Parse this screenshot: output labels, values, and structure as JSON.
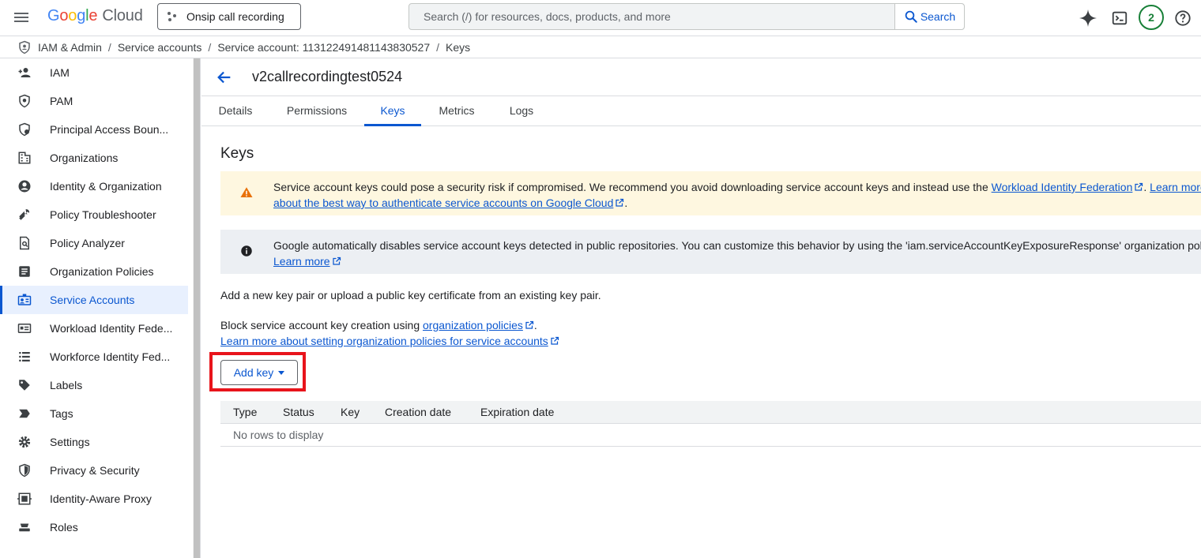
{
  "header": {
    "logo_google": [
      "G",
      "o",
      "o",
      "g",
      "l",
      "e"
    ],
    "logo_cloud": "Cloud",
    "project_name": "Onsip call recording",
    "search_placeholder": "Search (/) for resources, docs, products, and more",
    "search_button": "Search",
    "notification_count": "2"
  },
  "breadcrumb": {
    "items": [
      "IAM & Admin",
      "Service accounts",
      "Service account: 113122491481143830527",
      "Keys"
    ]
  },
  "sidebar": {
    "items": [
      {
        "label": "IAM",
        "icon": "person-add-icon"
      },
      {
        "label": "PAM",
        "icon": "shield-icon"
      },
      {
        "label": "Principal Access Boun...",
        "icon": "shield-gear-icon"
      },
      {
        "label": "Organizations",
        "icon": "building-icon"
      },
      {
        "label": "Identity & Organization",
        "icon": "account-circle-icon"
      },
      {
        "label": "Policy Troubleshooter",
        "icon": "wrench-icon"
      },
      {
        "label": "Policy Analyzer",
        "icon": "document-search-icon"
      },
      {
        "label": "Organization Policies",
        "icon": "list-doc-icon"
      },
      {
        "label": "Service Accounts",
        "icon": "service-account-icon",
        "active": true
      },
      {
        "label": "Workload Identity Fede...",
        "icon": "id-card-icon"
      },
      {
        "label": "Workforce Identity Fed...",
        "icon": "list-icon"
      },
      {
        "label": "Labels",
        "icon": "tag-icon"
      },
      {
        "label": "Tags",
        "icon": "label-arrow-icon"
      },
      {
        "label": "Settings",
        "icon": "gear-icon"
      },
      {
        "label": "Privacy & Security",
        "icon": "shield-half-icon"
      },
      {
        "label": "Identity-Aware Proxy",
        "icon": "proxy-icon"
      },
      {
        "label": "Roles",
        "icon": "roles-icon"
      }
    ]
  },
  "main": {
    "title": "v2callrecordingtest0524",
    "tabs": [
      "Details",
      "Permissions",
      "Keys",
      "Metrics",
      "Logs"
    ],
    "active_tab": "Keys",
    "section_title": "Keys",
    "warning": {
      "text1": "Service account keys could pose a security risk if compromised. We recommend you avoid downloading service account keys and instead use the ",
      "link1": "Workload Identity Federation",
      "text2": ". ",
      "link2a": "Learn more",
      "link2b": "about the best way to authenticate service accounts on Google Cloud",
      "text3": "."
    },
    "info": {
      "text1": "Google automatically disables service account keys detected in public repositories. You can customize this behavior by using the 'iam.serviceAccountKeyExposureResponse' organization policy.",
      "link1": "Learn more"
    },
    "para1": "Add a new key pair or upload a public key certificate from an existing key pair.",
    "para2": {
      "text1": "Block service account key creation using ",
      "link1": "organization policies",
      "text2": ".",
      "link2": "Learn more about setting organization policies for service accounts"
    },
    "add_key_label": "Add key",
    "table": {
      "columns": [
        "Type",
        "Status",
        "Key",
        "Creation date",
        "Expiration date"
      ],
      "empty_text": "No rows to display"
    }
  },
  "colors": {
    "accent": "#0b57d0",
    "warning_bg": "#fef7e0",
    "warning_icon": "#e8710a",
    "highlight": "#e8141b",
    "active_nav_bg": "#e8f0fe"
  }
}
